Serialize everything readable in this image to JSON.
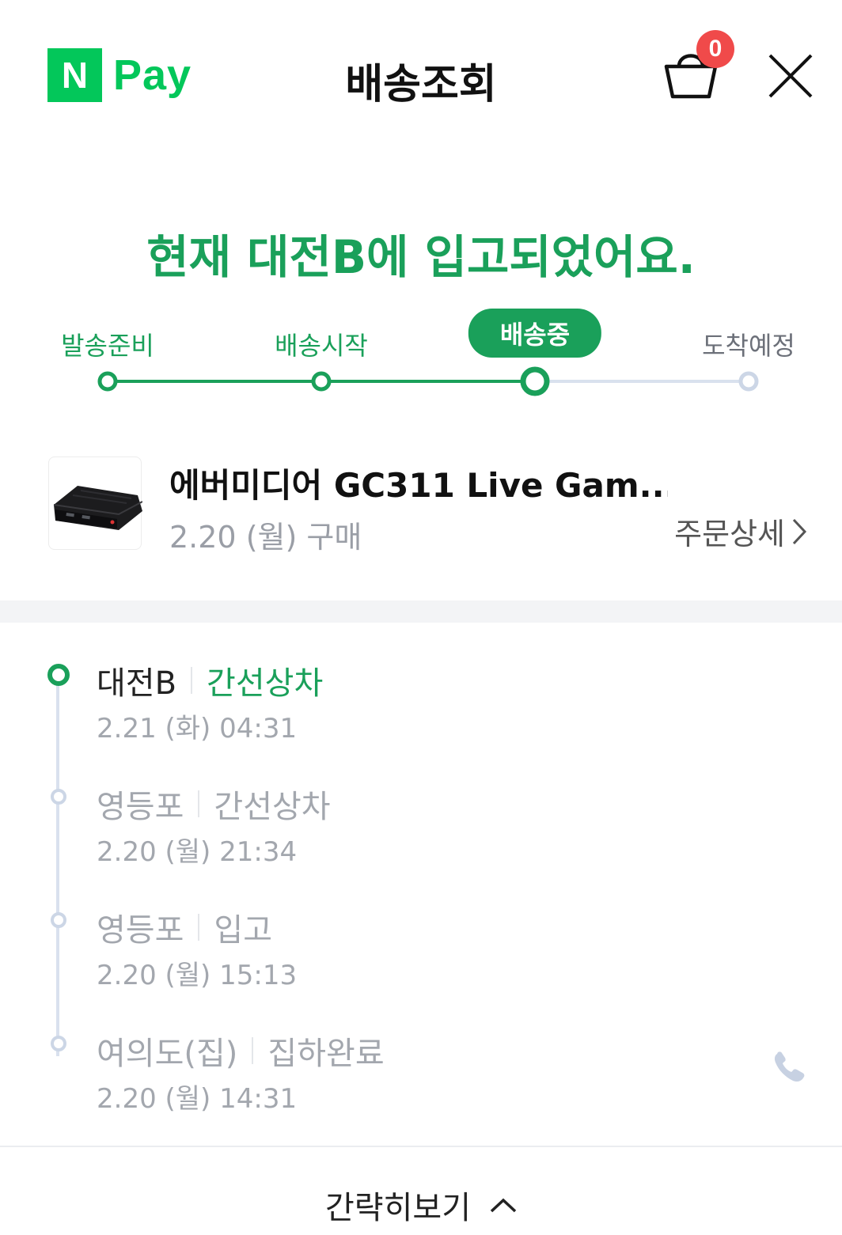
{
  "header": {
    "logo_mark": "N",
    "logo_text": "Pay",
    "title": "배송조회",
    "cart_count": "0"
  },
  "status": {
    "headline": "현재 대전B에 입고되었어요."
  },
  "steps": [
    {
      "label": "발송준비",
      "state": "done"
    },
    {
      "label": "배송시작",
      "state": "done"
    },
    {
      "label": "배송중",
      "state": "active"
    },
    {
      "label": "도착예정",
      "state": "todo"
    }
  ],
  "product": {
    "name": "에버미디어 GC311 Live Gam...",
    "purchase_date": "2.20 (월) 구매",
    "order_detail_label": "주문상세"
  },
  "timeline": [
    {
      "place": "대전B",
      "status": "간선상차",
      "time": "2.21 (화) 04:31",
      "current": true
    },
    {
      "place": "영등포",
      "status": "간선상차",
      "time": "2.20 (월) 21:34",
      "current": false
    },
    {
      "place": "영등포",
      "status": "입고",
      "time": "2.20 (월) 15:13",
      "current": false
    },
    {
      "place": "여의도(집)",
      "status": "집하완료",
      "time": "2.20 (월) 14:31",
      "current": false
    }
  ],
  "footer": {
    "collapse_label": "간략히보기"
  },
  "colors": {
    "brand_green": "#03c75a",
    "accent_green": "#1aa05a",
    "badge_red": "#f04a4a",
    "inactive": "#ccd6e6"
  },
  "icons": [
    "cart-icon",
    "close-icon",
    "chevron-right-icon",
    "phone-icon",
    "chevron-up-icon"
  ]
}
